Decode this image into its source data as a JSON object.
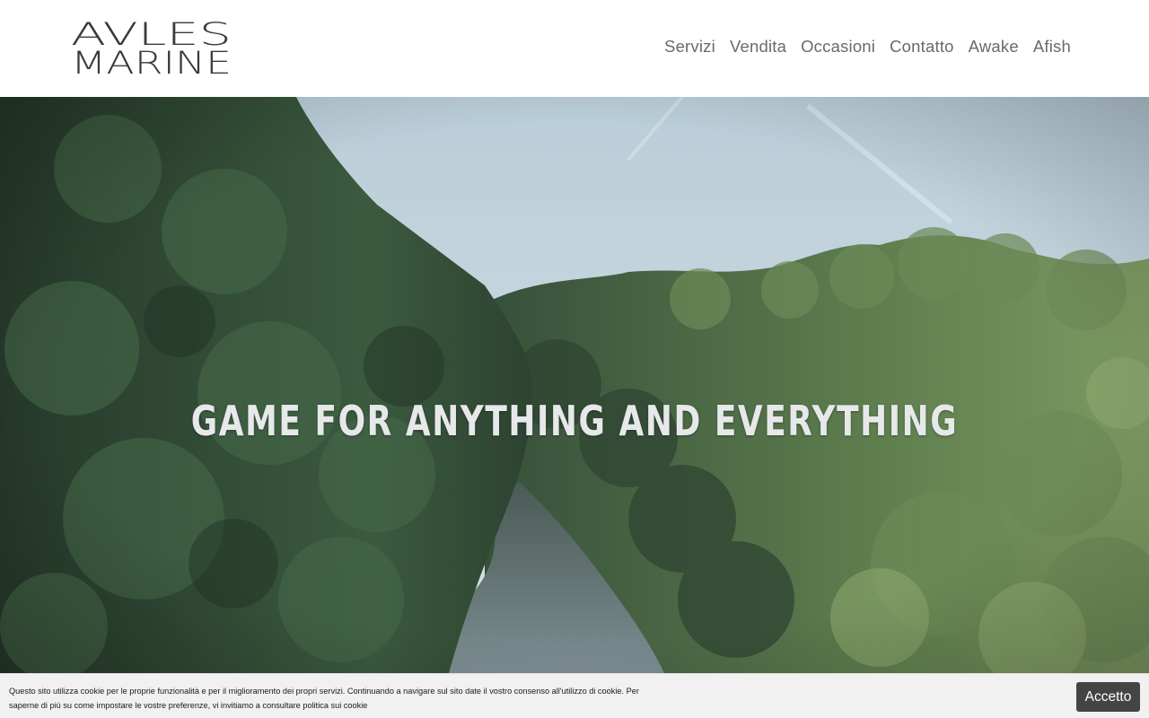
{
  "header": {
    "logo": {
      "line1": "AVLES",
      "line2": "MARINE"
    },
    "nav": [
      {
        "label": "Servizi"
      },
      {
        "label": "Vendita"
      },
      {
        "label": "Occasioni"
      },
      {
        "label": "Contatto"
      },
      {
        "label": "Awake"
      },
      {
        "label": "Afish"
      }
    ]
  },
  "hero": {
    "title": "GAME FOR ANYTHING AND EVERYTHING",
    "colors": {
      "sky": "#c9d8e0",
      "forest_dark": "#2f4a34",
      "forest_light": "#6f8f5a",
      "river": "#5d6f74"
    }
  },
  "cookie": {
    "text_before_link": "Questo sito utilizza cookie per le proprie funzionalità e per il miglioramento dei propri servizi. Continuando a navigare sul sito date il vostro consenso all'utilizzo di cookie. Per saperne di più su come impostare le vostre preferenze, vi invitiamo a consultare ",
    "link_label": "politica sui cookie",
    "accept_label": "Accetto"
  }
}
